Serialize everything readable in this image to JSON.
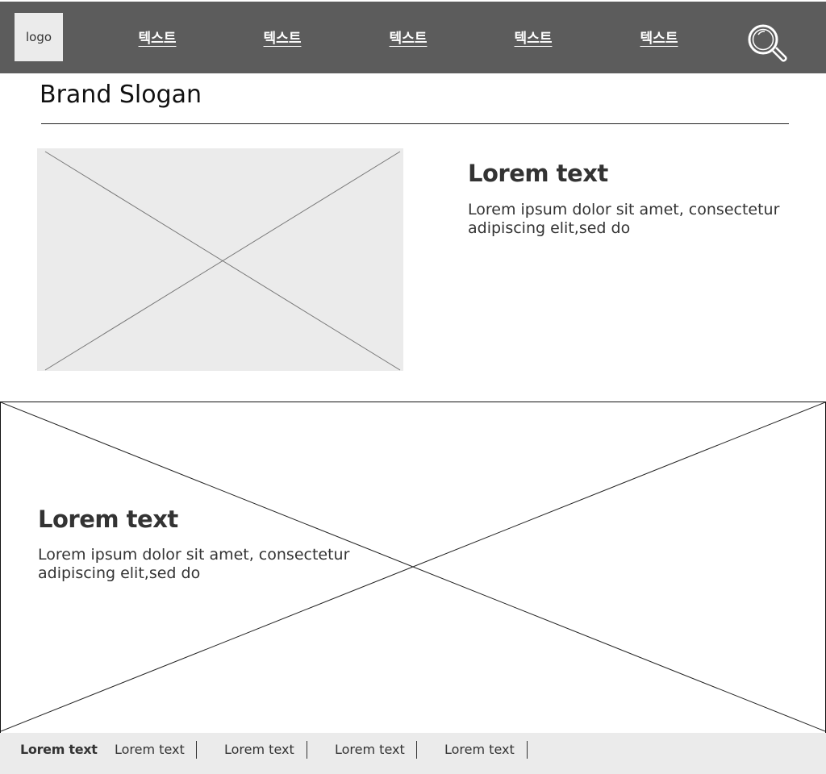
{
  "header": {
    "logo_text": "logo",
    "nav": [
      {
        "label": "텍스트"
      },
      {
        "label": "텍스트"
      },
      {
        "label": "텍스트"
      },
      {
        "label": "텍스트"
      },
      {
        "label": "텍스트"
      }
    ],
    "search_icon": "search-icon"
  },
  "slogan": "Brand Slogan",
  "feature": {
    "image": "image-placeholder",
    "title": "Lorem text",
    "body": "Lorem ipsum dolor sit amet, consectetur adipiscing elit,sed do"
  },
  "hero": {
    "image": "image-placeholder",
    "title": "Lorem text",
    "body": "Lorem ipsum dolor sit amet, consectetur adipiscing elit,sed do"
  },
  "footer": {
    "links": [
      {
        "label": "Lorem text"
      },
      {
        "label": "Lorem text"
      },
      {
        "label": "Lorem text"
      },
      {
        "label": "Lorem text"
      },
      {
        "label": "Lorem text"
      }
    ]
  },
  "colors": {
    "header_bg": "#5c5c5c",
    "placeholder_bg": "#ebebeb",
    "footer_bg": "#ebebeb",
    "text": "#333333"
  }
}
